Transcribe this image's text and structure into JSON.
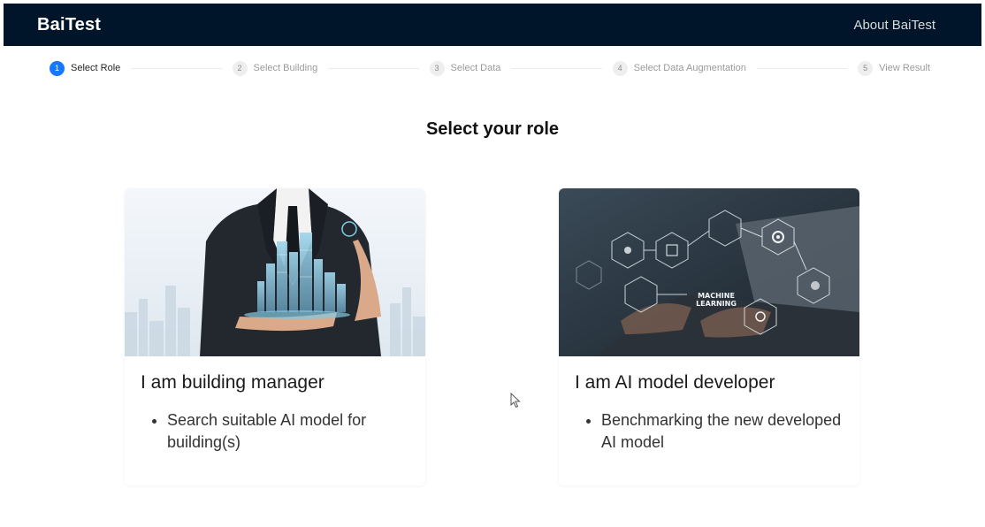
{
  "navbar": {
    "brand": "BaiTest",
    "about": "About BaiTest"
  },
  "steps": [
    {
      "number": "1",
      "label": "Select Role",
      "status": "active"
    },
    {
      "number": "2",
      "label": "Select Building",
      "status": "wait"
    },
    {
      "number": "3",
      "label": "Select Data",
      "status": "wait"
    },
    {
      "number": "4",
      "label": "Select Data Augmentation",
      "status": "wait"
    },
    {
      "number": "5",
      "label": "View Result",
      "status": "wait"
    }
  ],
  "main": {
    "heading": "Select your role",
    "cards": [
      {
        "title": "I am building manager",
        "bullets": [
          "Search suitable AI model for building(s)"
        ],
        "image_overlay_text": []
      },
      {
        "title": "I am AI model developer",
        "bullets": [
          "Benchmarking the new developed AI model"
        ],
        "image_overlay_text": [
          "MACHINE",
          "LEARNING"
        ]
      }
    ]
  },
  "colors": {
    "navbar_bg": "#001529",
    "accent": "#1677ff"
  }
}
